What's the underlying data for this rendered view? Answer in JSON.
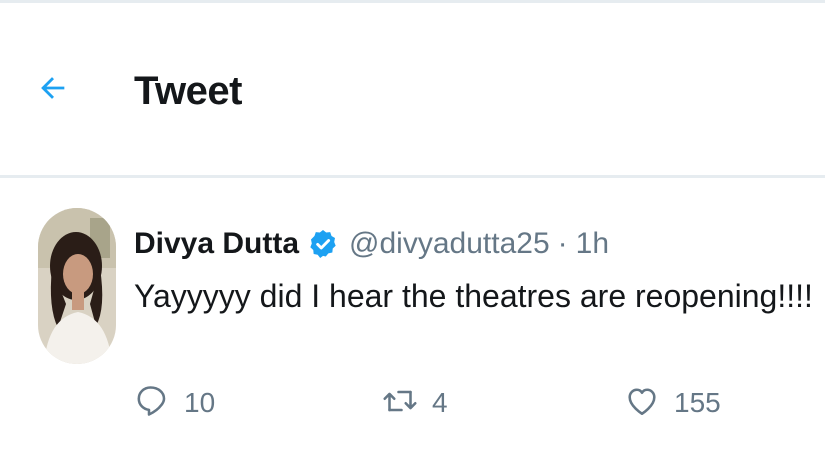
{
  "header": {
    "back_icon": "back-arrow-icon",
    "title": "Tweet"
  },
  "tweet": {
    "author": {
      "display_name": "Divya Dutta",
      "verified_icon": "verified-badge-icon",
      "handle": "@divyadutta25",
      "separator": "·",
      "timestamp": "1h"
    },
    "text": "Yayyyyy did I hear the theatres are reopening!!!!",
    "actions": {
      "reply": {
        "icon": "reply-icon",
        "count": "10"
      },
      "retweet": {
        "icon": "retweet-icon",
        "count": "4"
      },
      "like": {
        "icon": "heart-icon",
        "count": "155"
      }
    }
  },
  "colors": {
    "accent": "#1da1f2",
    "text_primary": "#14171a",
    "text_secondary": "#657786",
    "divider": "#e6ecf0"
  }
}
